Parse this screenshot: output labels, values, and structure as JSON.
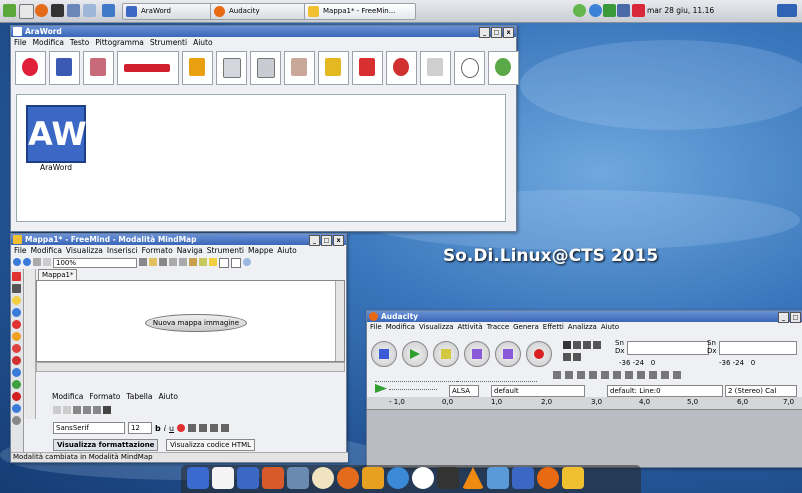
{
  "desktop": {
    "headline": "So.Di.Linux@CTS 2015"
  },
  "taskbar": {
    "tasks": [
      {
        "label": "AraWord"
      },
      {
        "label": "Audacity"
      },
      {
        "label": "Mappa1* - FreeMin..."
      }
    ],
    "clock": "mar 28 giu, 11.16"
  },
  "araword": {
    "title": "AraWord",
    "menu": [
      "File",
      "Modifica",
      "Testo",
      "Pittogramma",
      "Strumenti",
      "Aiuto"
    ],
    "doc_logo_text": "AW",
    "doc_logo_label": "AraWord"
  },
  "freemind": {
    "title": "Mappa1* - FreeMind - Modalità MindMap",
    "menu": [
      "File",
      "Modifica",
      "Visualizza",
      "Inserisci",
      "Formato",
      "Naviga",
      "Strumenti",
      "Mappe",
      "Aiuto"
    ],
    "zoom": "100%",
    "tab": "Mappa1*",
    "node": "Nuova mappa immagine",
    "editor_menu": [
      "Modifica",
      "Formato",
      "Tabella",
      "Aiuto"
    ],
    "font": "SansSerif",
    "font_size": "12",
    "tab_format": "Visualizza formattazione",
    "tab_html": "Visualizza codice HTML",
    "status": "Modalità cambiata in Modalità MindMap"
  },
  "audacity": {
    "title": "Audacity",
    "menu": [
      "File",
      "Modifica",
      "Visualizza",
      "Attività",
      "Tracce",
      "Genera",
      "Effetti",
      "Analizza",
      "Aiuto"
    ],
    "meter_left": "Sn",
    "meter_right": "Dx",
    "meter_scale": "-36 -24",
    "meter_zero": "0",
    "host": "ALSA",
    "output_device": "default",
    "input_device": "default: Line:0",
    "channels": "2 (Stereo) Cal",
    "ruler": [
      "- 1,0",
      "0,0",
      "1,0",
      "2,0",
      "3,0",
      "4,0",
      "5,0",
      "6,0",
      "7,0"
    ]
  }
}
